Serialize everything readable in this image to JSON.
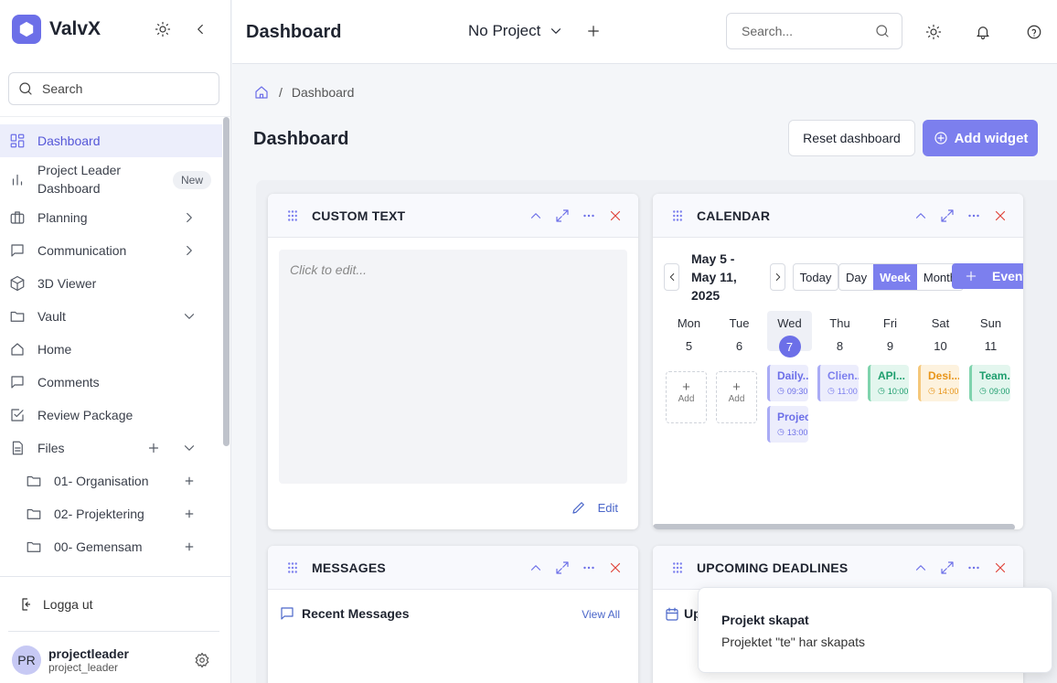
{
  "sidebar": {
    "brand": "ValvX",
    "search_label": "Search",
    "items": [
      {
        "label": "Dashboard"
      },
      {
        "label": "Project Leader Dashboard",
        "badge": "New"
      },
      {
        "label": "Planning"
      },
      {
        "label": "Communication"
      },
      {
        "label": "3D Viewer"
      },
      {
        "label": "Vault"
      },
      {
        "label": "Home"
      },
      {
        "label": "Comments"
      },
      {
        "label": "Review Package"
      },
      {
        "label": "Files"
      }
    ],
    "folders": [
      {
        "label": "01- Organisation"
      },
      {
        "label": "02- Projektering"
      },
      {
        "label": "00- Gemensam"
      }
    ],
    "logout": "Logga ut",
    "user": {
      "initials": "PR",
      "name": "projectleader",
      "role": "project_leader"
    }
  },
  "header": {
    "title": "Dashboard",
    "project": "No Project",
    "search_placeholder": "Search..."
  },
  "breadcrumb": {
    "current": "Dashboard"
  },
  "page": {
    "title": "Dashboard",
    "reset_label": "Reset dashboard",
    "add_widget_label": "Add widget"
  },
  "widgets": {
    "custom_text": {
      "title": "CUSTOM TEXT",
      "placeholder": "Click to edit...",
      "edit_label": "Edit"
    },
    "calendar": {
      "title": "CALENDAR",
      "range": "May 5 - May 11, 2025",
      "today_label": "Today",
      "views": [
        "Day",
        "Week",
        "Month"
      ],
      "active_view": "Week",
      "event_label": "Event",
      "add_label": "Add",
      "days": [
        {
          "name": "Mon",
          "date": "5"
        },
        {
          "name": "Tue",
          "date": "6"
        },
        {
          "name": "Wed",
          "date": "7"
        },
        {
          "name": "Thu",
          "date": "8"
        },
        {
          "name": "Fri",
          "date": "9"
        },
        {
          "name": "Sat",
          "date": "10"
        },
        {
          "name": "Sun",
          "date": "11"
        }
      ],
      "events": [
        {
          "title": "Daily...",
          "time": "09:30",
          "color": "#7c7fee"
        },
        {
          "title": "Project",
          "time": "13:00",
          "color": "#7c7fee"
        },
        {
          "title": "Clien...",
          "time": "11:00",
          "color": "#8a8cf0"
        },
        {
          "title": "API...",
          "time": "10:00",
          "color": "#22b07d"
        },
        {
          "title": "Desi...",
          "time": "14:00",
          "color": "#f0a020"
        },
        {
          "title": "Team...",
          "time": "09:00",
          "color": "#22b07d"
        }
      ]
    },
    "messages": {
      "title": "MESSAGES",
      "subtitle": "Recent Messages",
      "view_all": "View All"
    },
    "deadlines": {
      "title": "UPCOMING DEADLINES",
      "subtitle": "Up"
    }
  },
  "toast": {
    "title": "Projekt skapat",
    "message": "Projektet \"te\" har skapats"
  },
  "colors": {
    "accent": "#6c6fe8",
    "danger": "#e0443b",
    "link": "#4a66c9"
  }
}
